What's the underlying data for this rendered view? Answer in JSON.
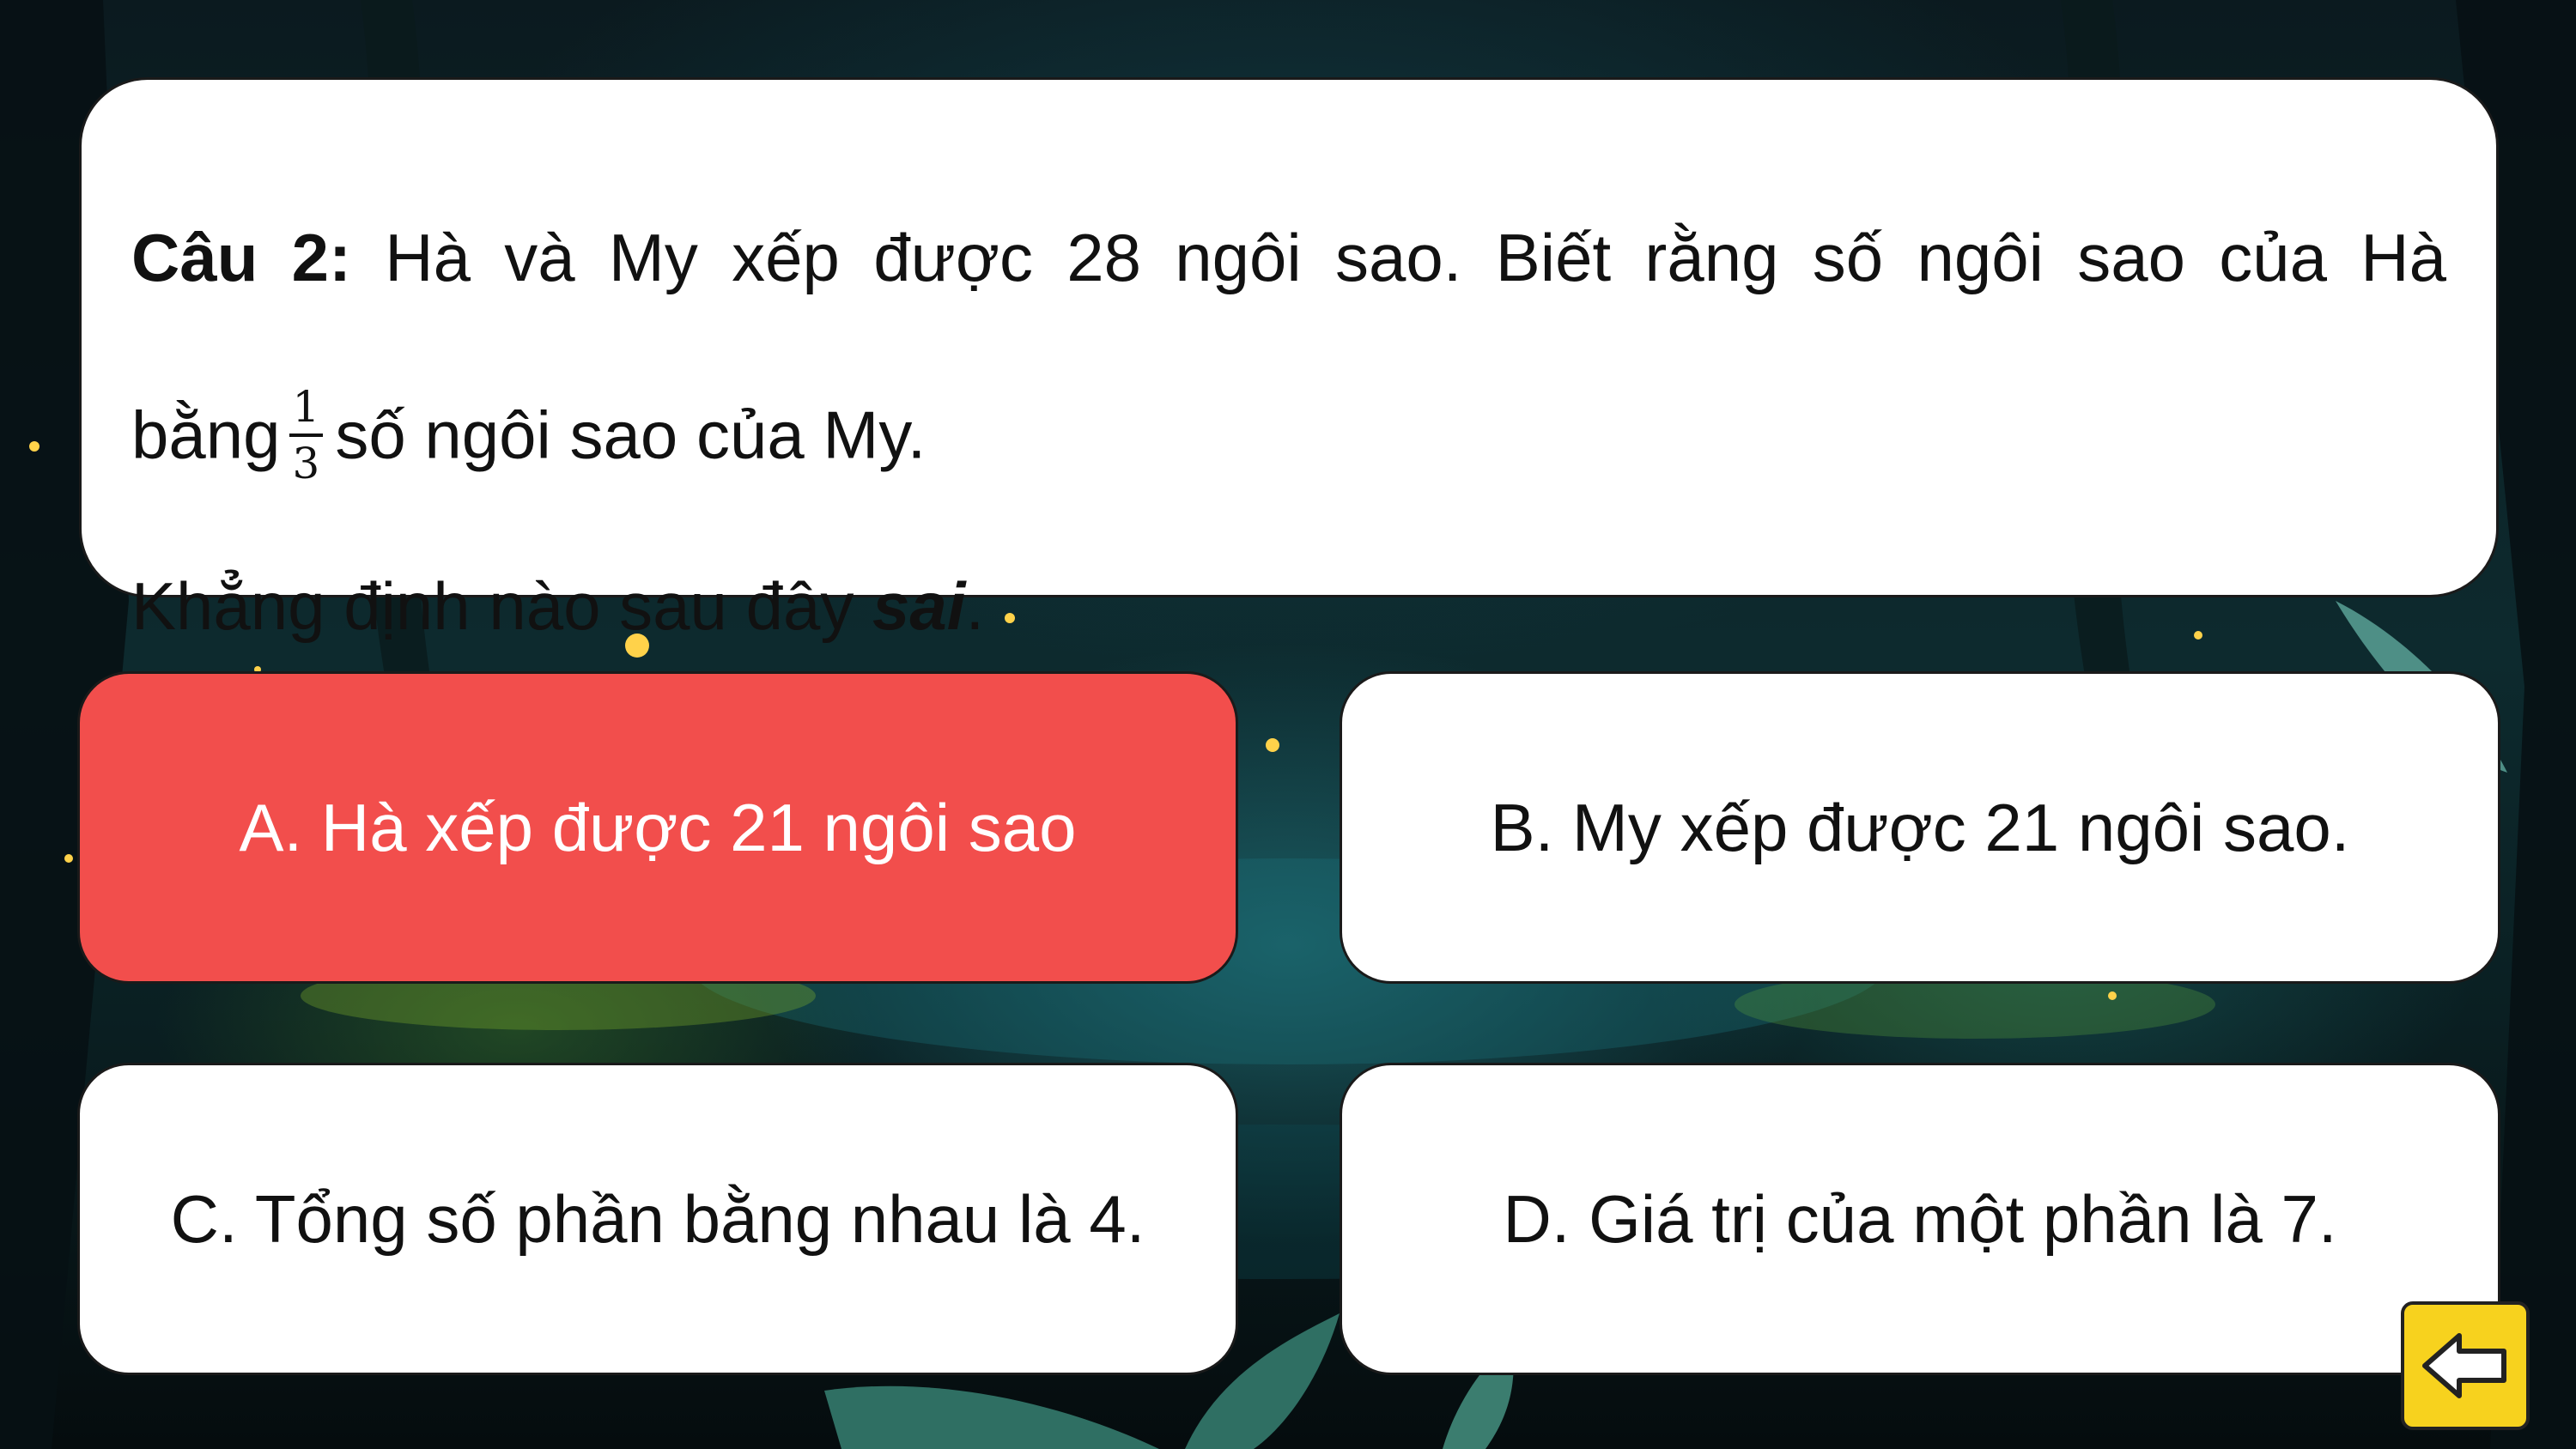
{
  "question": {
    "label": "Câu 2:",
    "line1_text": "Hà và My xếp được 28 ngôi sao. Biết rằng số ngôi sao của Hà",
    "line2_prefix": "bằng",
    "fraction_numerator": "1",
    "fraction_denominator": "3",
    "line2_suffix": "số ngôi sao của My.",
    "line3_prefix": "Khẳng định nào sau đây",
    "line3_emphasis": "sai",
    "line3_suffix": "."
  },
  "answers": [
    {
      "label": "A. Hà xếp được 21 ngôi sao",
      "state": "selected-wrong",
      "color": "#f24e4c"
    },
    {
      "label": "B. My xếp được 21 ngôi sao.",
      "state": "default",
      "color": "#ffffff"
    },
    {
      "label": "C. Tổng số phần bằng nhau là 4.",
      "state": "default",
      "color": "#ffffff"
    },
    {
      "label": "D. Giá trị của một phần là 7.",
      "state": "default",
      "color": "#ffffff"
    }
  ],
  "back_button": {
    "icon": "arrow-left-icon",
    "color": "#f7d21e"
  }
}
